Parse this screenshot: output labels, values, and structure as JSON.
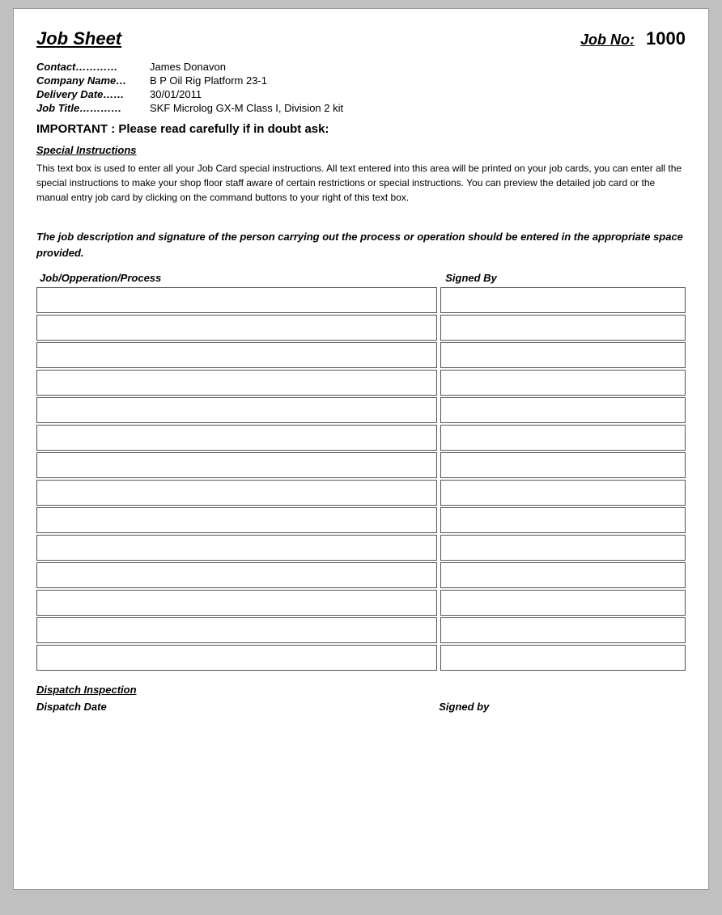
{
  "header": {
    "title": "Job Sheet",
    "job_no_label": "Job No:",
    "job_no_value": "1000"
  },
  "info": {
    "contact_label": "Contact…………",
    "contact_value": "James Donavon",
    "company_label": "Company Name…",
    "company_value": "B P Oil Rig Platform 23-1",
    "delivery_label": "Delivery Date……",
    "delivery_value": "30/01/2011",
    "job_title_label": "Job Title…………",
    "job_title_value": "SKF Microlog GX-M Class I, Division 2 kit"
  },
  "important_notice": "IMPORTANT : Please read carefully if in doubt ask:",
  "special_instructions": {
    "label": "Special Instructions",
    "text": "This text box is used to enter all your Job Card special instructions. All text entered into this area will be printed on your job cards, you can enter all the special instructions to make your shop floor staff aware of certain restrictions or special instructions. You can preview the detailed job card or the manual entry job card by clicking on the command buttons to your right of this text box."
  },
  "job_desc_note": "The job description and signature of the person carrying out the process or operation should be entered in the appropriate space provided.",
  "table": {
    "col_job_label": "Job/Opperation/Process",
    "col_signed_label": "Signed By",
    "row_count": 14
  },
  "dispatch": {
    "label": "Dispatch Inspection",
    "date_label": "Dispatch Date",
    "signed_label": "Signed by"
  }
}
